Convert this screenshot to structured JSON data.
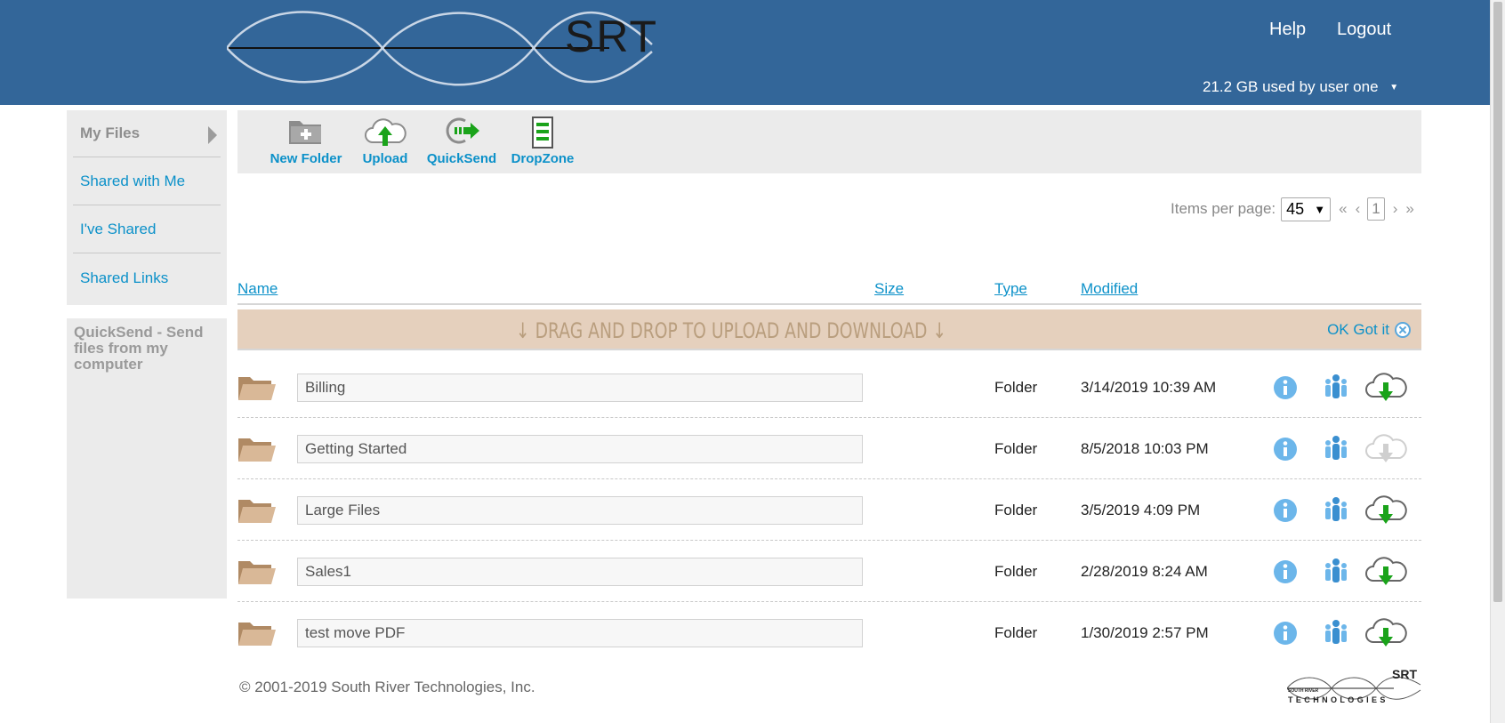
{
  "header": {
    "logo_text": "SRT",
    "help_label": "Help",
    "logout_label": "Logout",
    "storage_used": "21.2 GB used by",
    "user_name": "user one"
  },
  "sidebar": {
    "items": [
      {
        "label": "My Files",
        "active": true
      },
      {
        "label": "Shared with Me"
      },
      {
        "label": "I've Shared"
      },
      {
        "label": "Shared Links"
      }
    ],
    "quicksend_label": "QuickSend - Send files from my computer"
  },
  "toolbar": {
    "new_folder_label": "New Folder",
    "upload_label": "Upload",
    "quicksend_label": "QuickSend",
    "dropzone_label": "DropZone"
  },
  "pager": {
    "items_per_page_label": "Items per page:",
    "items_per_page_value": "45",
    "first": "«",
    "prev": "‹",
    "current_page": "1",
    "next": "›",
    "last": "»"
  },
  "columns": {
    "name": "Name",
    "size": "Size",
    "type": "Type",
    "modified": "Modified"
  },
  "banner": {
    "text": "↓ DRAG AND DROP TO UPLOAD AND DOWNLOAD ↓",
    "dismiss_label": "OK Got it"
  },
  "files": [
    {
      "name": "Billing",
      "size": "",
      "type": "Folder",
      "modified": "3/14/2019 10:39 AM",
      "download_enabled": true
    },
    {
      "name": "Getting Started",
      "size": "",
      "type": "Folder",
      "modified": "8/5/2018 10:03 PM",
      "download_enabled": false
    },
    {
      "name": "Large Files",
      "size": "",
      "type": "Folder",
      "modified": "3/5/2019 4:09 PM",
      "download_enabled": true
    },
    {
      "name": "Sales1",
      "size": "",
      "type": "Folder",
      "modified": "2/28/2019 8:24 AM",
      "download_enabled": true
    },
    {
      "name": "test move PDF",
      "size": "",
      "type": "Folder",
      "modified": "1/30/2019 2:57 PM",
      "download_enabled": true
    }
  ],
  "footer": {
    "copyright": "© 2001-2019 South River Technologies, Inc.",
    "logo_srt": "SRT",
    "logo_sub": "SOUTH RIVER",
    "logo_tech": "TECHNOLOGIES"
  },
  "colors": {
    "header_bg": "#336699",
    "link_blue": "#0c91c9",
    "banner_bg": "#e5d0bd",
    "folder_tan": "#c9a27e",
    "download_green": "#1aa31a"
  }
}
